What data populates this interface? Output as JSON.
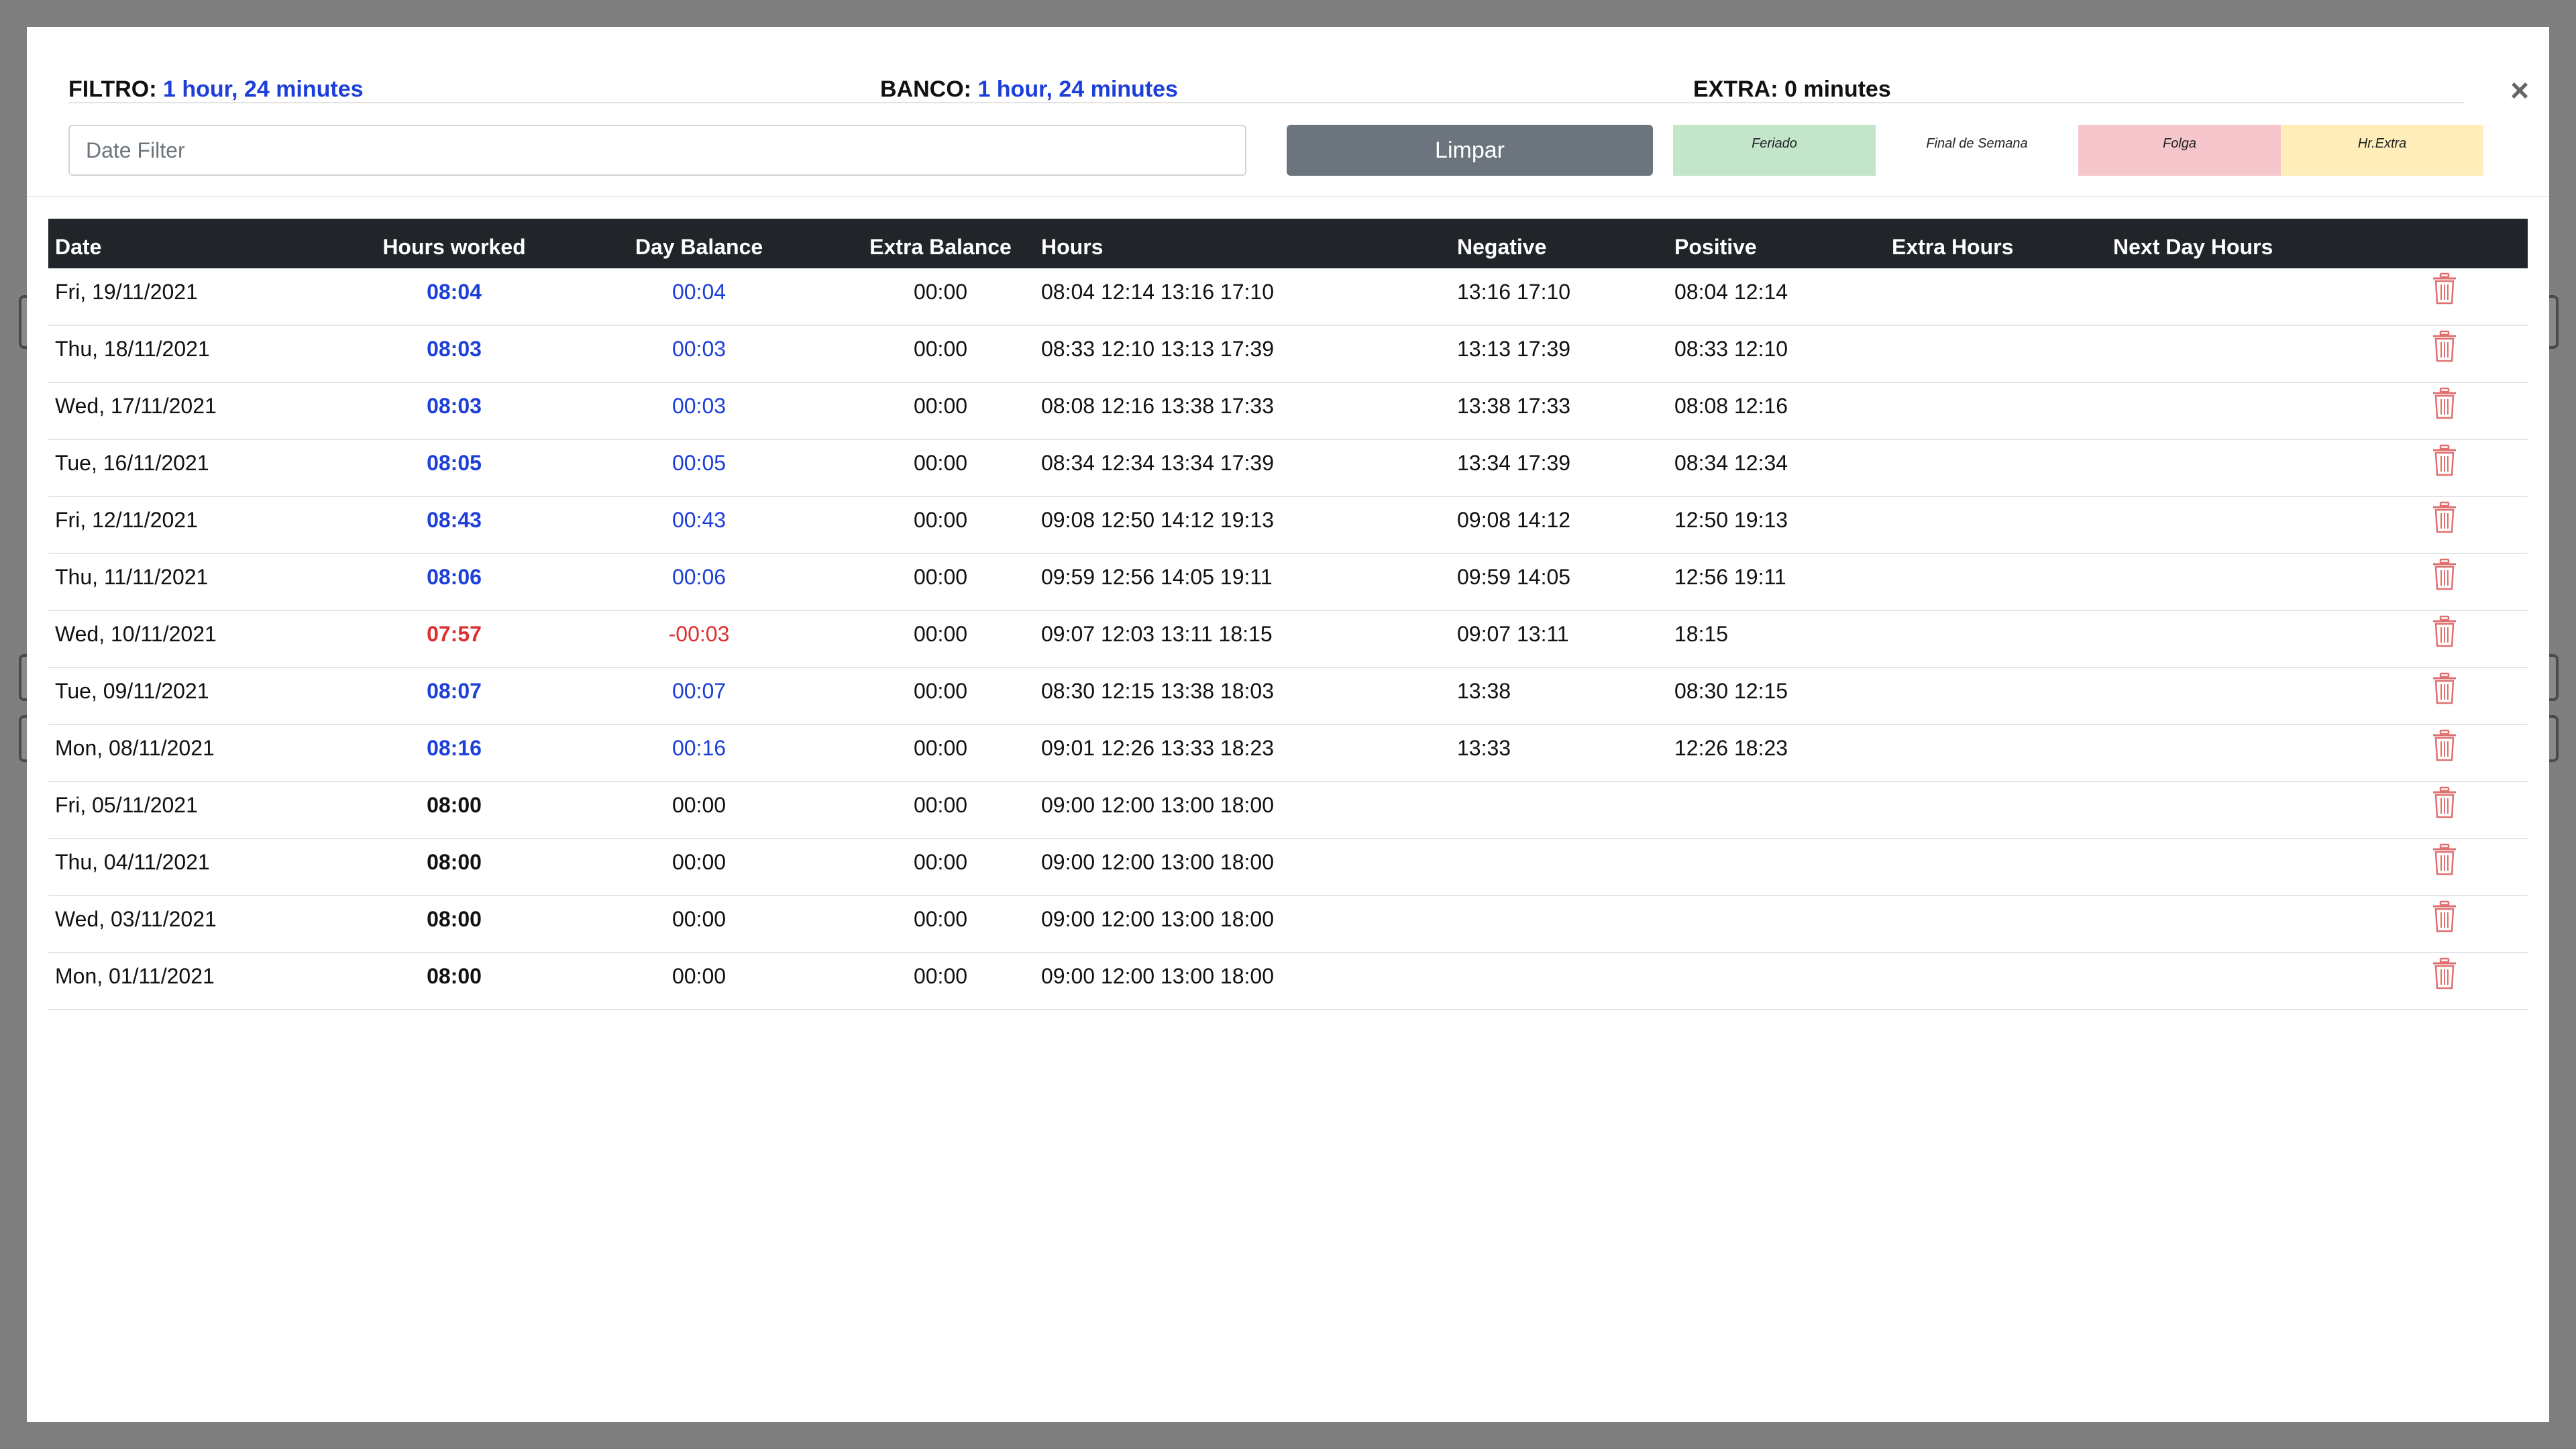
{
  "summary": {
    "filtro_label": "FILTRO:",
    "filtro_value": "1 hour, 24 minutes",
    "banco_label": "BANCO:",
    "banco_value": "1 hour, 24 minutes",
    "extra_label": "EXTRA:",
    "extra_value": "0 minutes"
  },
  "close_label": "×",
  "filter": {
    "placeholder": "Date Filter",
    "value": ""
  },
  "clear_button": "Limpar",
  "legend": [
    {
      "label": "Feriado",
      "color": "#c3e6cb"
    },
    {
      "label": "Final de Semana",
      "color": "#ffffff"
    },
    {
      "label": "Folga",
      "color": "#f5c6cb"
    },
    {
      "label": "Hr.Extra",
      "color": "#ffeeba"
    }
  ],
  "colors": {
    "positive": "#1d3fd9",
    "negative": "#dc3030",
    "header_bg": "#212529",
    "delete_icon": "#e07070"
  },
  "table": {
    "columns": [
      "Date",
      "Hours worked",
      "Day Balance",
      "Extra Balance",
      "Hours",
      "Negative",
      "Positive",
      "Extra Hours",
      "Next Day Hours"
    ],
    "rows": [
      {
        "date": "Fri, 19/11/2021",
        "worked": "08:04",
        "balance": "00:04",
        "extra_balance": "00:00",
        "hours": "08:04 12:14 13:16 17:10",
        "negative": "13:16 17:10",
        "positive": "08:04 12:14",
        "extra_hours": "",
        "next_day": "",
        "status": "positive"
      },
      {
        "date": "Thu, 18/11/2021",
        "worked": "08:03",
        "balance": "00:03",
        "extra_balance": "00:00",
        "hours": "08:33 12:10 13:13 17:39",
        "negative": "13:13 17:39",
        "positive": "08:33 12:10",
        "extra_hours": "",
        "next_day": "",
        "status": "positive"
      },
      {
        "date": "Wed, 17/11/2021",
        "worked": "08:03",
        "balance": "00:03",
        "extra_balance": "00:00",
        "hours": "08:08 12:16 13:38 17:33",
        "negative": "13:38 17:33",
        "positive": "08:08 12:16",
        "extra_hours": "",
        "next_day": "",
        "status": "positive"
      },
      {
        "date": "Tue, 16/11/2021",
        "worked": "08:05",
        "balance": "00:05",
        "extra_balance": "00:00",
        "hours": "08:34 12:34 13:34 17:39",
        "negative": "13:34 17:39",
        "positive": "08:34 12:34",
        "extra_hours": "",
        "next_day": "",
        "status": "positive"
      },
      {
        "date": "Fri, 12/11/2021",
        "worked": "08:43",
        "balance": "00:43",
        "extra_balance": "00:00",
        "hours": "09:08 12:50 14:12 19:13",
        "negative": "09:08 14:12",
        "positive": "12:50 19:13",
        "extra_hours": "",
        "next_day": "",
        "status": "positive"
      },
      {
        "date": "Thu, 11/11/2021",
        "worked": "08:06",
        "balance": "00:06",
        "extra_balance": "00:00",
        "hours": "09:59 12:56 14:05 19:11",
        "negative": "09:59 14:05",
        "positive": "12:56 19:11",
        "extra_hours": "",
        "next_day": "",
        "status": "positive"
      },
      {
        "date": "Wed, 10/11/2021",
        "worked": "07:57",
        "balance": "-00:03",
        "extra_balance": "00:00",
        "hours": "09:07 12:03 13:11 18:15",
        "negative": "09:07 13:11",
        "positive": "18:15",
        "extra_hours": "",
        "next_day": "",
        "status": "negative"
      },
      {
        "date": "Tue, 09/11/2021",
        "worked": "08:07",
        "balance": "00:07",
        "extra_balance": "00:00",
        "hours": "08:30 12:15 13:38 18:03",
        "negative": "13:38",
        "positive": "08:30 12:15",
        "extra_hours": "",
        "next_day": "",
        "status": "positive"
      },
      {
        "date": "Mon, 08/11/2021",
        "worked": "08:16",
        "balance": "00:16",
        "extra_balance": "00:00",
        "hours": "09:01 12:26 13:33 18:23",
        "negative": "13:33",
        "positive": "12:26 18:23",
        "extra_hours": "",
        "next_day": "",
        "status": "positive"
      },
      {
        "date": "Fri, 05/11/2021",
        "worked": "08:00",
        "balance": "00:00",
        "extra_balance": "00:00",
        "hours": "09:00 12:00 13:00 18:00",
        "negative": "",
        "positive": "",
        "extra_hours": "",
        "next_day": "",
        "status": "neutral"
      },
      {
        "date": "Thu, 04/11/2021",
        "worked": "08:00",
        "balance": "00:00",
        "extra_balance": "00:00",
        "hours": "09:00 12:00 13:00 18:00",
        "negative": "",
        "positive": "",
        "extra_hours": "",
        "next_day": "",
        "status": "neutral"
      },
      {
        "date": "Wed, 03/11/2021",
        "worked": "08:00",
        "balance": "00:00",
        "extra_balance": "00:00",
        "hours": "09:00 12:00 13:00 18:00",
        "negative": "",
        "positive": "",
        "extra_hours": "",
        "next_day": "",
        "status": "neutral"
      },
      {
        "date": "Mon, 01/11/2021",
        "worked": "08:00",
        "balance": "00:00",
        "extra_balance": "00:00",
        "hours": "09:00 12:00 13:00 18:00",
        "negative": "",
        "positive": "",
        "extra_hours": "",
        "next_day": "",
        "status": "neutral"
      }
    ]
  }
}
